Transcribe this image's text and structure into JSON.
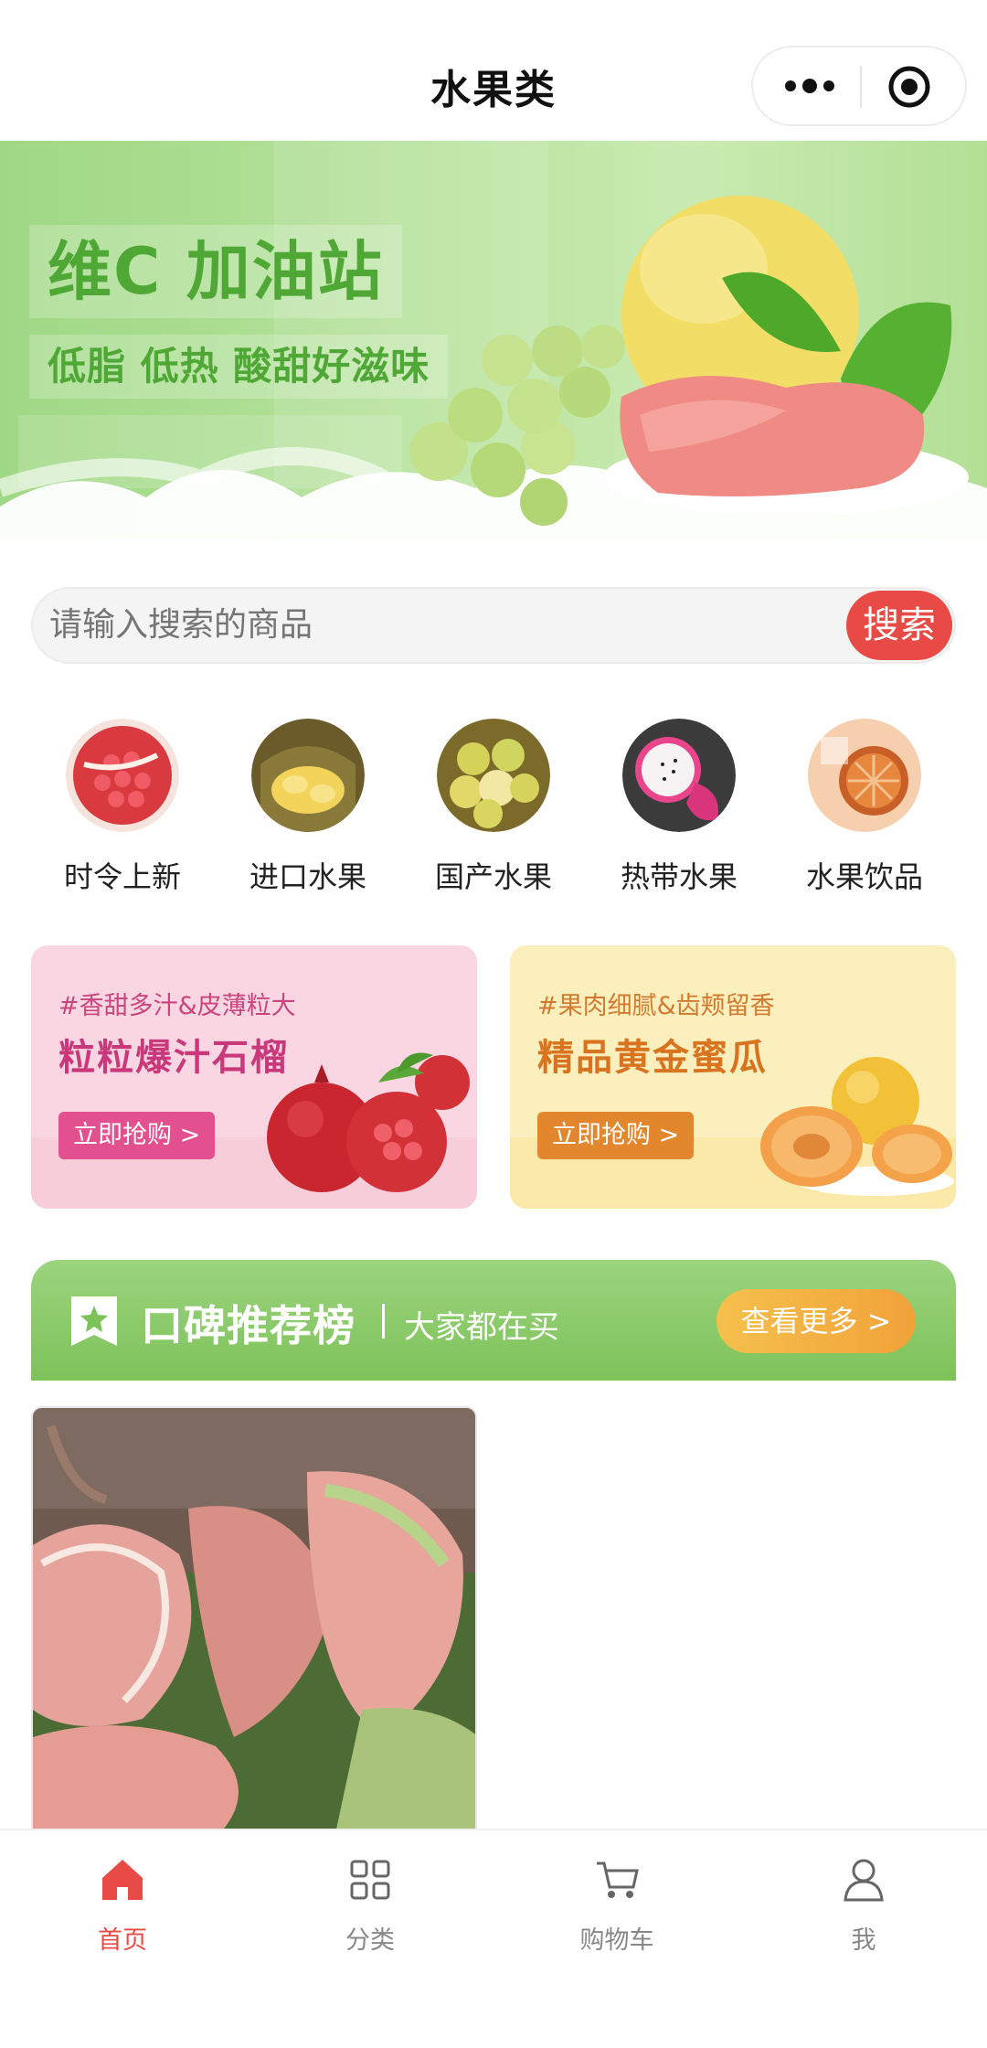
{
  "nav": {
    "title": "水果类"
  },
  "banner": {
    "title": "维C 加油站",
    "subtitle": "低脂 低热 酸甜好滋味"
  },
  "search": {
    "placeholder": "请输入搜索的商品",
    "button": "搜索"
  },
  "categories": [
    {
      "label": "时令上新",
      "icon": "pomegranate-icon"
    },
    {
      "label": "进口水果",
      "icon": "durian-icon"
    },
    {
      "label": "国产水果",
      "icon": "jujube-icon"
    },
    {
      "label": "热带水果",
      "icon": "dragon-fruit-icon"
    },
    {
      "label": "水果饮品",
      "icon": "orange-drink-icon"
    }
  ],
  "promos": [
    {
      "tag": "#香甜多汁&皮薄粒大",
      "title": "粒粒爆汁石榴",
      "button": "立即抢购 >",
      "bg": "#f9d6e2",
      "tag_color": "#c9457d",
      "title_color": "#c9387a",
      "button_color": "#e2508f"
    },
    {
      "tag": "#果肉细腻&齿颊留香",
      "title": "精品黄金蜜瓜",
      "button": "立即抢购 >",
      "bg": "#fbefbd",
      "tag_color": "#d27a30",
      "title_color": "#d8731f",
      "button_color": "#e3872f"
    }
  ],
  "ranking": {
    "title": "口碑推荐榜",
    "subtitle": "大家都在买",
    "more": "查看更多 >"
  },
  "tabbar": [
    {
      "label": "首页",
      "icon": "home-icon",
      "active": true
    },
    {
      "label": "分类",
      "icon": "category-icon",
      "active": false
    },
    {
      "label": "购物车",
      "icon": "cart-icon",
      "active": false
    },
    {
      "label": "我",
      "icon": "user-icon",
      "active": false
    }
  ],
  "colors": {
    "accent": "#e84a45",
    "green": "#7ec25a",
    "banner_text": "#4fa836"
  }
}
